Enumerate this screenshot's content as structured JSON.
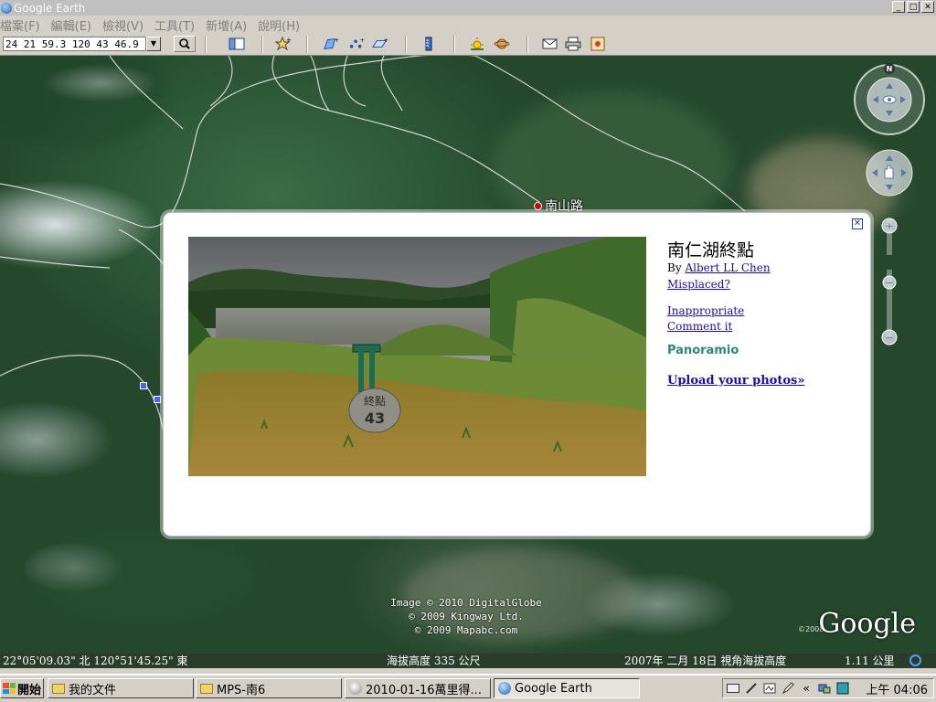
{
  "window": {
    "title": "Google Earth",
    "minimize": "_",
    "maximize": "□",
    "close": "✕"
  },
  "menu": [
    {
      "label": "檔案(F)"
    },
    {
      "label": "編輯(E)"
    },
    {
      "label": "檢視(V)"
    },
    {
      "label": "工具(T)"
    },
    {
      "label": "新增(A)"
    },
    {
      "label": "說明(H)"
    }
  ],
  "toolbar": {
    "coordinate_value": "24 21 59.3 120 43 46.9"
  },
  "map": {
    "road_label": "南山路",
    "credits": [
      "Image © 2010 DigitalGlobe",
      "© 2009 Kingway Ltd.",
      "© 2009 Mapabc.com"
    ],
    "google_logo": "Google",
    "google_year": "©2008",
    "north_label": "N"
  },
  "popup": {
    "title": "南仁湖終點",
    "by_prefix": "By",
    "author": "Albert LL Chen",
    "misplaced": "Misplaced?",
    "inappropriate": "Inappropriate",
    "comment": "Comment it",
    "brand": "Panoramio",
    "upload": "Upload your photos»",
    "stone_text": "終點",
    "stone_number": "43",
    "close": "✕"
  },
  "status": {
    "coords": "22°05'09.03\" 北   120°51'45.25\" 東",
    "elevation": "海拔高度   335 公尺",
    "date_eye": "2007年 二月 18日 視角海拔高度",
    "eye_value": "1.11 公里"
  },
  "taskbar": {
    "start": "開始",
    "tasks": [
      {
        "label": "我的文件"
      },
      {
        "label": "MPS-南6"
      },
      {
        "label": "2010-01-16萬里得..."
      },
      {
        "label": "Google Earth"
      }
    ],
    "clock": "上午 04:06",
    "tray_chevron": "«"
  },
  "colors": {
    "link": "#1a0dab",
    "panoramio": "#2a8a74",
    "taskbar": "#d4d0c8"
  }
}
